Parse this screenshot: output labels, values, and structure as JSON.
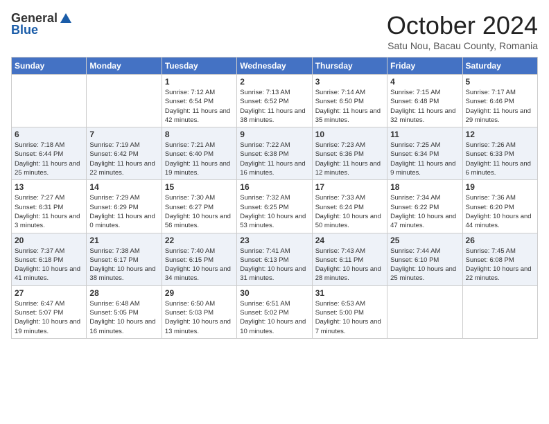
{
  "header": {
    "logo_general": "General",
    "logo_blue": "Blue",
    "month_title": "October 2024",
    "location": "Satu Nou, Bacau County, Romania"
  },
  "days_of_week": [
    "Sunday",
    "Monday",
    "Tuesday",
    "Wednesday",
    "Thursday",
    "Friday",
    "Saturday"
  ],
  "weeks": [
    [
      {
        "day": "",
        "info": ""
      },
      {
        "day": "",
        "info": ""
      },
      {
        "day": "1",
        "info": "Sunrise: 7:12 AM\nSunset: 6:54 PM\nDaylight: 11 hours and 42 minutes."
      },
      {
        "day": "2",
        "info": "Sunrise: 7:13 AM\nSunset: 6:52 PM\nDaylight: 11 hours and 38 minutes."
      },
      {
        "day": "3",
        "info": "Sunrise: 7:14 AM\nSunset: 6:50 PM\nDaylight: 11 hours and 35 minutes."
      },
      {
        "day": "4",
        "info": "Sunrise: 7:15 AM\nSunset: 6:48 PM\nDaylight: 11 hours and 32 minutes."
      },
      {
        "day": "5",
        "info": "Sunrise: 7:17 AM\nSunset: 6:46 PM\nDaylight: 11 hours and 29 minutes."
      }
    ],
    [
      {
        "day": "6",
        "info": "Sunrise: 7:18 AM\nSunset: 6:44 PM\nDaylight: 11 hours and 25 minutes."
      },
      {
        "day": "7",
        "info": "Sunrise: 7:19 AM\nSunset: 6:42 PM\nDaylight: 11 hours and 22 minutes."
      },
      {
        "day": "8",
        "info": "Sunrise: 7:21 AM\nSunset: 6:40 PM\nDaylight: 11 hours and 19 minutes."
      },
      {
        "day": "9",
        "info": "Sunrise: 7:22 AM\nSunset: 6:38 PM\nDaylight: 11 hours and 16 minutes."
      },
      {
        "day": "10",
        "info": "Sunrise: 7:23 AM\nSunset: 6:36 PM\nDaylight: 11 hours and 12 minutes."
      },
      {
        "day": "11",
        "info": "Sunrise: 7:25 AM\nSunset: 6:34 PM\nDaylight: 11 hours and 9 minutes."
      },
      {
        "day": "12",
        "info": "Sunrise: 7:26 AM\nSunset: 6:33 PM\nDaylight: 11 hours and 6 minutes."
      }
    ],
    [
      {
        "day": "13",
        "info": "Sunrise: 7:27 AM\nSunset: 6:31 PM\nDaylight: 11 hours and 3 minutes."
      },
      {
        "day": "14",
        "info": "Sunrise: 7:29 AM\nSunset: 6:29 PM\nDaylight: 11 hours and 0 minutes."
      },
      {
        "day": "15",
        "info": "Sunrise: 7:30 AM\nSunset: 6:27 PM\nDaylight: 10 hours and 56 minutes."
      },
      {
        "day": "16",
        "info": "Sunrise: 7:32 AM\nSunset: 6:25 PM\nDaylight: 10 hours and 53 minutes."
      },
      {
        "day": "17",
        "info": "Sunrise: 7:33 AM\nSunset: 6:24 PM\nDaylight: 10 hours and 50 minutes."
      },
      {
        "day": "18",
        "info": "Sunrise: 7:34 AM\nSunset: 6:22 PM\nDaylight: 10 hours and 47 minutes."
      },
      {
        "day": "19",
        "info": "Sunrise: 7:36 AM\nSunset: 6:20 PM\nDaylight: 10 hours and 44 minutes."
      }
    ],
    [
      {
        "day": "20",
        "info": "Sunrise: 7:37 AM\nSunset: 6:18 PM\nDaylight: 10 hours and 41 minutes."
      },
      {
        "day": "21",
        "info": "Sunrise: 7:38 AM\nSunset: 6:17 PM\nDaylight: 10 hours and 38 minutes."
      },
      {
        "day": "22",
        "info": "Sunrise: 7:40 AM\nSunset: 6:15 PM\nDaylight: 10 hours and 34 minutes."
      },
      {
        "day": "23",
        "info": "Sunrise: 7:41 AM\nSunset: 6:13 PM\nDaylight: 10 hours and 31 minutes."
      },
      {
        "day": "24",
        "info": "Sunrise: 7:43 AM\nSunset: 6:11 PM\nDaylight: 10 hours and 28 minutes."
      },
      {
        "day": "25",
        "info": "Sunrise: 7:44 AM\nSunset: 6:10 PM\nDaylight: 10 hours and 25 minutes."
      },
      {
        "day": "26",
        "info": "Sunrise: 7:45 AM\nSunset: 6:08 PM\nDaylight: 10 hours and 22 minutes."
      }
    ],
    [
      {
        "day": "27",
        "info": "Sunrise: 6:47 AM\nSunset: 5:07 PM\nDaylight: 10 hours and 19 minutes."
      },
      {
        "day": "28",
        "info": "Sunrise: 6:48 AM\nSunset: 5:05 PM\nDaylight: 10 hours and 16 minutes."
      },
      {
        "day": "29",
        "info": "Sunrise: 6:50 AM\nSunset: 5:03 PM\nDaylight: 10 hours and 13 minutes."
      },
      {
        "day": "30",
        "info": "Sunrise: 6:51 AM\nSunset: 5:02 PM\nDaylight: 10 hours and 10 minutes."
      },
      {
        "day": "31",
        "info": "Sunrise: 6:53 AM\nSunset: 5:00 PM\nDaylight: 10 hours and 7 minutes."
      },
      {
        "day": "",
        "info": ""
      },
      {
        "day": "",
        "info": ""
      }
    ]
  ]
}
